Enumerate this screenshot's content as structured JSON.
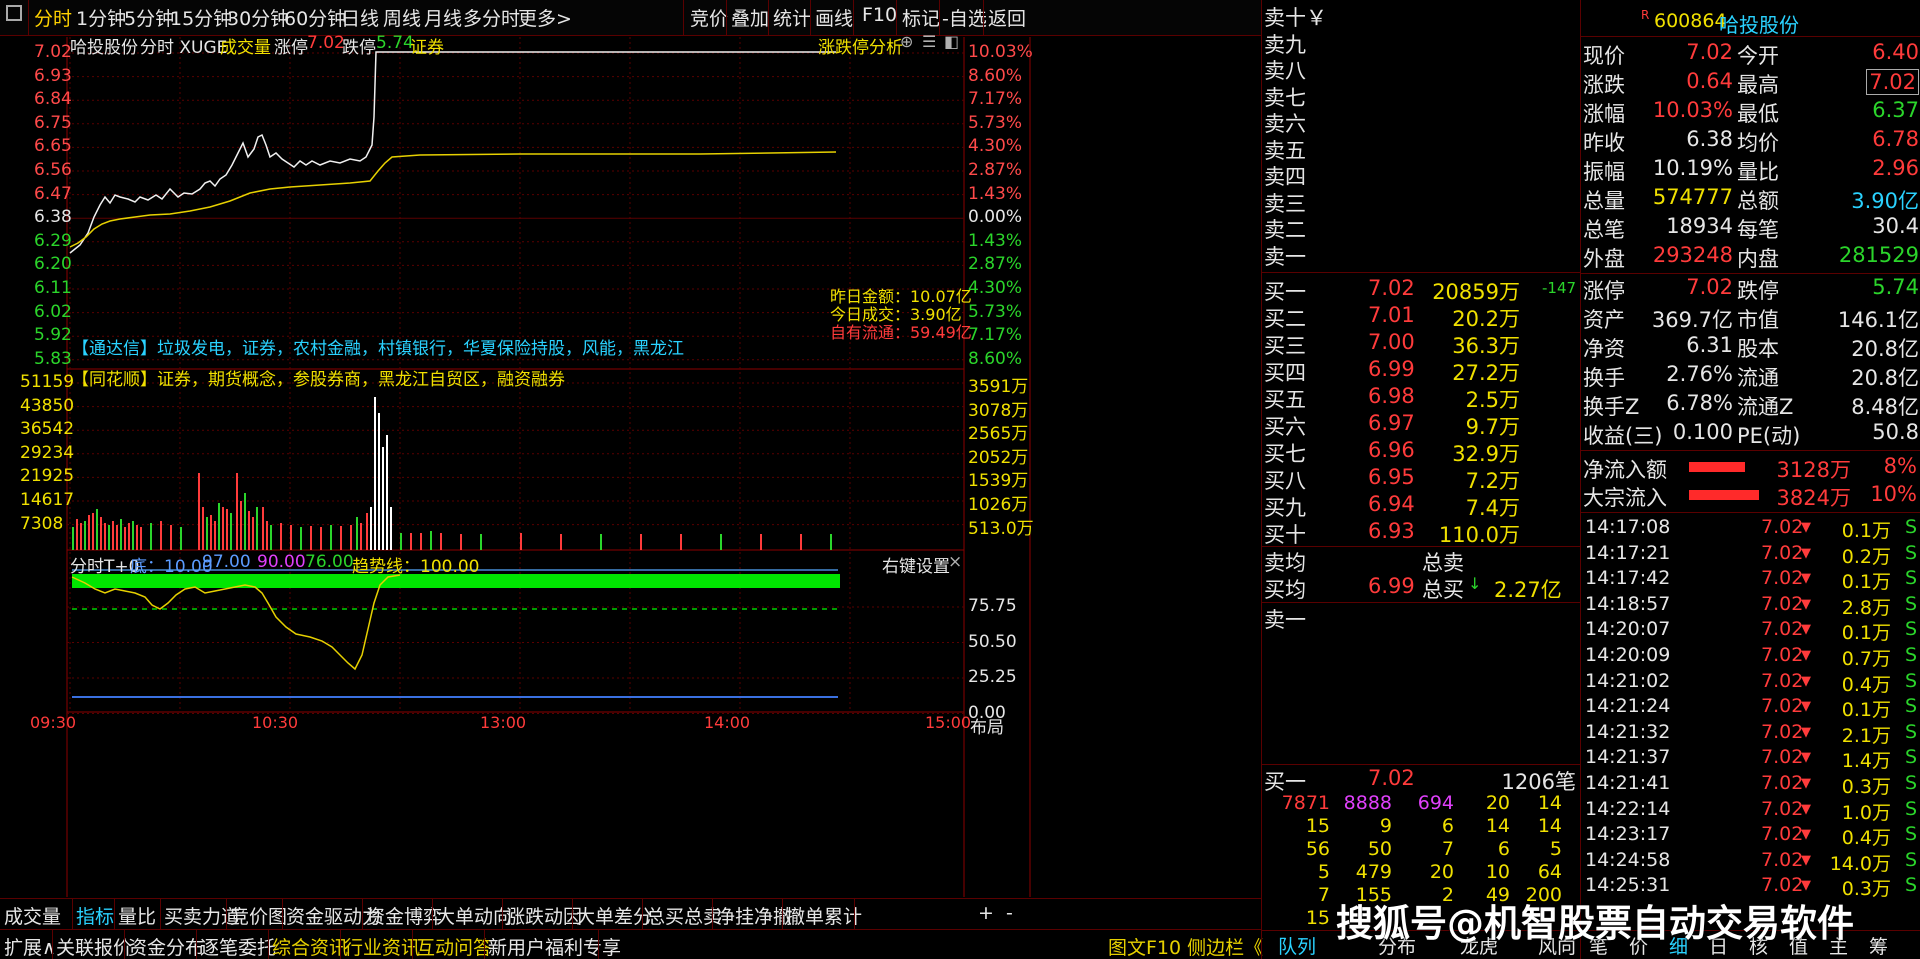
{
  "topbar": {
    "left_tabs": [
      "分时",
      "1分钟",
      "5分钟",
      "15分钟",
      "30分钟",
      "60分钟",
      "日线",
      "周线",
      "月线",
      "多分时",
      "更多>"
    ],
    "right_tabs": [
      "竞价",
      "叠加",
      "统计",
      "画线",
      "F10",
      "标记",
      "-自选",
      "返回"
    ]
  },
  "chart": {
    "stock_name": "哈投股份",
    "mode": "分时 XUGE",
    "volume_label": "成交量",
    "limit_up_label": "涨停",
    "limit_up_value": "7.02",
    "limit_down_label": "跌停",
    "limit_down_value": "5.74",
    "concept": "证券",
    "analysis_link": "涨跌停分析",
    "price_ticks": [
      "7.02",
      "6.93",
      "6.84",
      "6.75",
      "6.65",
      "6.56",
      "6.47",
      "6.38",
      "6.29",
      "6.20",
      "6.11",
      "6.02",
      "5.92",
      "5.83"
    ],
    "pct_ticks": [
      "10.03%",
      "8.60%",
      "7.17%",
      "5.73%",
      "4.30%",
      "2.87%",
      "1.43%",
      "0.00%",
      "1.43%",
      "2.87%",
      "4.30%",
      "5.73%",
      "7.17%",
      "8.60%"
    ],
    "vol_ticks_left": [
      "51159",
      "43850",
      "36542",
      "29234",
      "21925",
      "14617",
      "7308"
    ],
    "vol_ticks_right": [
      "3591万",
      "3078万",
      "2565万",
      "2052万",
      "1539万",
      "1026万",
      "513.0万"
    ],
    "info_box": {
      "yesterday_amount": "昨日金额：10.07亿",
      "today_amount": "今日成交：3.90亿",
      "free_float": "自有流通：59.49亿"
    },
    "tdx_tags": "【通达信】垃圾发电，证券，农村金融，村镇银行，华夏保险持股，风能，黑龙江",
    "ths_tags": "【同花顺】证券，期货概念，参股券商，黑龙江自贸区，融资融券",
    "indicator": {
      "name": "分时T+0",
      "bottom": "底：10.00",
      "v97": "97.00",
      "v90": "90.00",
      "v76": "76.00",
      "trend": "趋势线：100.00",
      "settings": "右键设置",
      "close": "×",
      "ticks": [
        "75.75",
        "50.50",
        "25.25",
        "0.00"
      ]
    },
    "time_ticks": [
      "09:30",
      "10:30",
      "13:00",
      "14:00",
      "15:00"
    ],
    "layout_label": "布局"
  },
  "bottom_tabs_row1": [
    "成交量",
    "指标",
    "量比",
    "买卖力道",
    "竞价图",
    "资金驱动力",
    "资金博弈",
    "大单动向",
    "涨跌动因",
    "大单差分",
    "总买总卖",
    "净挂净撤",
    "撤单累计"
  ],
  "bottom_row1_right": [
    "+",
    "-"
  ],
  "bottom_tabs_row2": [
    "扩展∧",
    "关联报价",
    "资金分布",
    "逐笔委托",
    "综合资讯",
    "行业资讯",
    "互动问答",
    "新用户福利专享"
  ],
  "bottom_row2_right": "图文F10 侧边栏《",
  "order_book": {
    "sell_labels": [
      "卖十￥",
      "卖九",
      "卖八",
      "卖七",
      "卖六",
      "卖五",
      "卖四",
      "卖三",
      "卖二",
      "卖一"
    ],
    "buy_rows": [
      {
        "label": "买一",
        "price": "7.02",
        "vol": "20859万",
        "chg": "-147"
      },
      {
        "label": "买二",
        "price": "7.01",
        "vol": "20.2万",
        "chg": ""
      },
      {
        "label": "买三",
        "price": "7.00",
        "vol": "36.3万",
        "chg": ""
      },
      {
        "label": "买四",
        "price": "6.99",
        "vol": "27.2万",
        "chg": ""
      },
      {
        "label": "买五",
        "price": "6.98",
        "vol": "2.5万",
        "chg": ""
      },
      {
        "label": "买六",
        "price": "6.97",
        "vol": "9.7万",
        "chg": ""
      },
      {
        "label": "买七",
        "price": "6.96",
        "vol": "32.9万",
        "chg": ""
      },
      {
        "label": "买八",
        "price": "6.95",
        "vol": "7.2万",
        "chg": ""
      },
      {
        "label": "买九",
        "price": "6.94",
        "vol": "7.4万",
        "chg": ""
      },
      {
        "label": "买十",
        "price": "6.93",
        "vol": "110.0万",
        "chg": ""
      }
    ],
    "sell_avg_label": "卖均",
    "total_sell_label": "总卖",
    "buy_avg_label": "买均",
    "buy_avg_value": "6.99",
    "total_buy_label": "总买",
    "total_buy_value": "2.27亿",
    "sell1_label": "卖一",
    "buy1_queue_label": "买一",
    "buy1_queue_price": "7.02",
    "buy1_queue_count": "1206笔",
    "queue": [
      [
        "7871",
        "8888",
        "694",
        "20",
        "14"
      ],
      [
        "15",
        "9",
        "6",
        "14",
        "14"
      ],
      [
        "56",
        "50",
        "7",
        "6",
        "5"
      ],
      [
        "5",
        "479",
        "20",
        "10",
        "64"
      ],
      [
        "7",
        "155",
        "2",
        "49",
        "200"
      ],
      [
        "15",
        "",
        "",
        "",
        ""
      ]
    ],
    "bottom_tabs": [
      "队列",
      "分布",
      "龙虎",
      "风向"
    ]
  },
  "quote": {
    "r_badge": "R",
    "code": "600864",
    "name": "哈投股份",
    "rows": [
      {
        "l1": "现价",
        "v1": "7.02",
        "l2": "今开",
        "v2": "6.40"
      },
      {
        "l1": "涨跌",
        "v1": "0.64",
        "l2": "最高",
        "v2": "7.02"
      },
      {
        "l1": "涨幅",
        "v1": "10.03%",
        "l2": "最低",
        "v2": "6.37"
      },
      {
        "l1": "昨收",
        "v1": "6.38",
        "l2": "均价",
        "v2": "6.78"
      },
      {
        "l1": "振幅",
        "v1": "10.19%",
        "l2": "量比",
        "v2": "2.96"
      },
      {
        "l1": "总量",
        "v1": "574777",
        "l2": "总额",
        "v2": "3.90亿"
      },
      {
        "l1": "总笔",
        "v1": "18934",
        "l2": "每笔",
        "v2": "30.4"
      },
      {
        "l1": "外盘",
        "v1": "293248",
        "l2": "内盘",
        "v2": "281529"
      }
    ],
    "rows2": [
      {
        "l1": "涨停",
        "v1": "7.02",
        "l2": "跌停",
        "v2": "5.74"
      },
      {
        "l1": "资产",
        "v1": "369.7亿",
        "l2": "市值",
        "v2": "146.1亿"
      },
      {
        "l1": "净资",
        "v1": "6.31",
        "l2": "股本",
        "v2": "20.8亿"
      },
      {
        "l1": "换手",
        "v1": "2.76%",
        "l2": "流通",
        "v2": "20.8亿"
      },
      {
        "l1": "换手Z",
        "v1": "6.78%",
        "l2": "流通Z",
        "v2": "8.48亿"
      },
      {
        "l1": "收益(三)",
        "v1": "0.100",
        "l2": "PE(动)",
        "v2": "50.8"
      }
    ],
    "netflow": {
      "label": "净流入额",
      "value": "3128万",
      "pct": "8%"
    },
    "blockflow": {
      "label": "大宗流入",
      "value": "3824万",
      "pct": "10%"
    },
    "trades": [
      {
        "t": "14:17:08",
        "p": "7.02",
        "v": "0.1万",
        "s": "S"
      },
      {
        "t": "14:17:21",
        "p": "7.02",
        "v": "0.2万",
        "s": "S"
      },
      {
        "t": "14:17:42",
        "p": "7.02",
        "v": "0.1万",
        "s": "S"
      },
      {
        "t": "14:18:57",
        "p": "7.02",
        "v": "2.8万",
        "s": "S"
      },
      {
        "t": "14:20:07",
        "p": "7.02",
        "v": "0.1万",
        "s": "S"
      },
      {
        "t": "14:20:09",
        "p": "7.02",
        "v": "0.7万",
        "s": "S"
      },
      {
        "t": "14:21:02",
        "p": "7.02",
        "v": "0.4万",
        "s": "S"
      },
      {
        "t": "14:21:24",
        "p": "7.02",
        "v": "0.1万",
        "s": "S"
      },
      {
        "t": "14:21:32",
        "p": "7.02",
        "v": "2.1万",
        "s": "S"
      },
      {
        "t": "14:21:37",
        "p": "7.02",
        "v": "1.4万",
        "s": "S"
      },
      {
        "t": "14:21:41",
        "p": "7.02",
        "v": "0.3万",
        "s": "S"
      },
      {
        "t": "14:22:14",
        "p": "7.02",
        "v": "1.0万",
        "s": "S"
      },
      {
        "t": "14:23:17",
        "p": "7.02",
        "v": "0.4万",
        "s": "S"
      },
      {
        "t": "14:24:58",
        "p": "7.02",
        "v": "14.0万",
        "s": "S"
      },
      {
        "t": "14:25:31",
        "p": "7.02",
        "v": "0.3万",
        "s": "S"
      }
    ],
    "bottom_tabs": [
      "笔",
      "价",
      "细",
      "日",
      "核",
      "值",
      "主",
      "筹"
    ]
  },
  "watermark": "搜狐号@机智股票自动交易软件"
}
